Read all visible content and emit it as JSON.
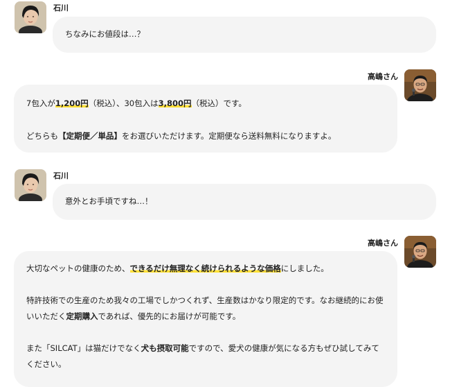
{
  "messages": [
    {
      "speaker": "石川",
      "text": "ちなみにお値段は…？"
    },
    {
      "speaker": "高嶋さん",
      "line1": {
        "a": "7包入が",
        "b": "1,200円",
        "c": "（税込）、30包入は",
        "d": "3,800円",
        "e": "（税込）です。"
      },
      "line2": {
        "a": "どちらも",
        "b": "【定期便／単品】",
        "c": "をお選びいただけます。定期便なら送料無料になりますよ。"
      }
    },
    {
      "speaker": "石川",
      "text": "意外とお手頃ですね…！"
    },
    {
      "speaker": "高嶋さん",
      "p1": {
        "a": "大切なペットの健康のため、",
        "b": "できるだけ無理なく続けられるような価格",
        "c": "にしました。"
      },
      "p2": {
        "a": "特許技術での生産のため我々の工場でしかつくれず、生産数はかなり限定的です。なお継続的にお使いいただく",
        "b": "定期購入",
        "c": "であれば、優先的にお届けが可能です。"
      },
      "p3": {
        "a": "また「SILCAT」は猫だけでなく",
        "b": "犬も摂取可能",
        "c": "ですので、愛犬の健康が気になる方もぜひ試してみてください。"
      }
    }
  ],
  "icons": {
    "left_avatar": "woman-avatar-icon",
    "right_avatar": "man-with-microphone-avatar-icon"
  },
  "colors": {
    "bubble": "#f4f4f4",
    "highlight": "#ffe135",
    "text": "#222222"
  }
}
